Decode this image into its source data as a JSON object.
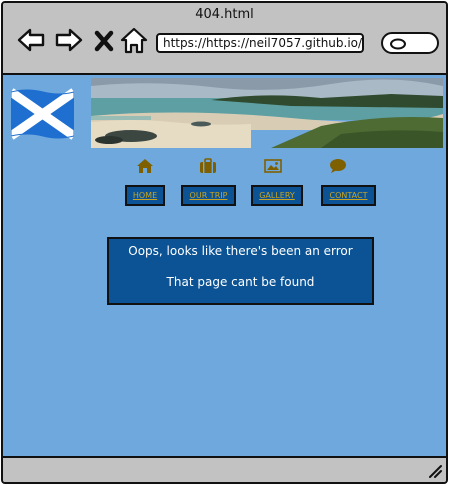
{
  "window": {
    "title": "404.html"
  },
  "toolbar": {
    "url": "https://https://neil7057.github.io/",
    "icons": [
      "back-arrow-icon",
      "forward-arrow-icon",
      "close-x-icon",
      "home-icon",
      "search-icon"
    ]
  },
  "nav": {
    "icons": [
      "home-icon",
      "suitcase-icon",
      "image-icon",
      "chat-bubble-icon"
    ],
    "items": [
      {
        "label": "HOME"
      },
      {
        "label": "OUR TRIP"
      },
      {
        "label": "GALLERY"
      },
      {
        "label": "CONTACT"
      }
    ]
  },
  "error": {
    "line1": "Oops, looks like there's been an error",
    "line2": "That page cant be found"
  },
  "colors": {
    "page_background": "#6fa8dc",
    "panel_blue": "#0b5394",
    "menu_text_gold": "#c8a422",
    "icon_brown": "#7f6000",
    "chrome_gray": "#c2c2c2"
  }
}
